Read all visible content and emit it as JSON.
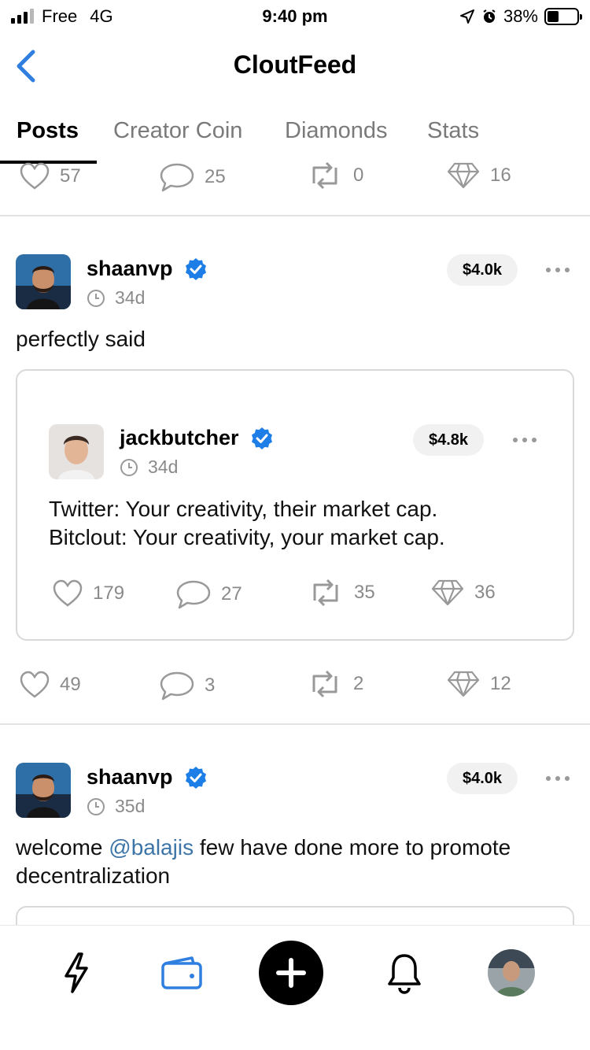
{
  "status_bar": {
    "carrier": "Free",
    "network": "4G",
    "time": "9:40 pm",
    "battery": "38%",
    "battery_level": 0.38
  },
  "header": {
    "title": "CloutFeed",
    "back_icon": "chevron-left-icon"
  },
  "tabs": [
    {
      "label": "Posts",
      "active": true
    },
    {
      "label": "Creator Coin",
      "active": false
    },
    {
      "label": "Diamonds",
      "active": false
    },
    {
      "label": "Stats",
      "active": false
    }
  ],
  "top_actions": {
    "likes": "57",
    "comments": "25",
    "reclouts": "0",
    "diamonds": "16"
  },
  "posts": [
    {
      "username": "shaanvp",
      "time": "34d",
      "coin_price": "$4.0k",
      "text": "perfectly said",
      "quote": {
        "username": "jackbutcher",
        "time": "34d",
        "coin_price": "$4.8k",
        "text_lines": [
          "Twitter: Your creativity, their market cap.",
          "Bitclout: Your creativity, your market cap."
        ],
        "actions": {
          "likes": "179",
          "comments": "27",
          "reclouts": "35",
          "diamonds": "36"
        }
      },
      "actions": {
        "likes": "49",
        "comments": "3",
        "reclouts": "2",
        "diamonds": "12"
      }
    },
    {
      "username": "shaanvp",
      "time": "35d",
      "coin_price": "$4.0k",
      "text_before": "welcome ",
      "mention": "@balajis",
      "text_after": " few have done more to promote",
      "text_line2": "decentralization"
    }
  ],
  "bottom_nav": [
    {
      "icon": "lightning-icon"
    },
    {
      "icon": "wallet-icon"
    },
    {
      "icon": "plus-icon"
    },
    {
      "icon": "bell-icon"
    },
    {
      "icon": "profile-avatar"
    }
  ],
  "colors": {
    "accent": "#2f7fe0",
    "verified": "#1d7ee8",
    "muted": "#8a8a8a",
    "mention": "#3d75a8"
  }
}
